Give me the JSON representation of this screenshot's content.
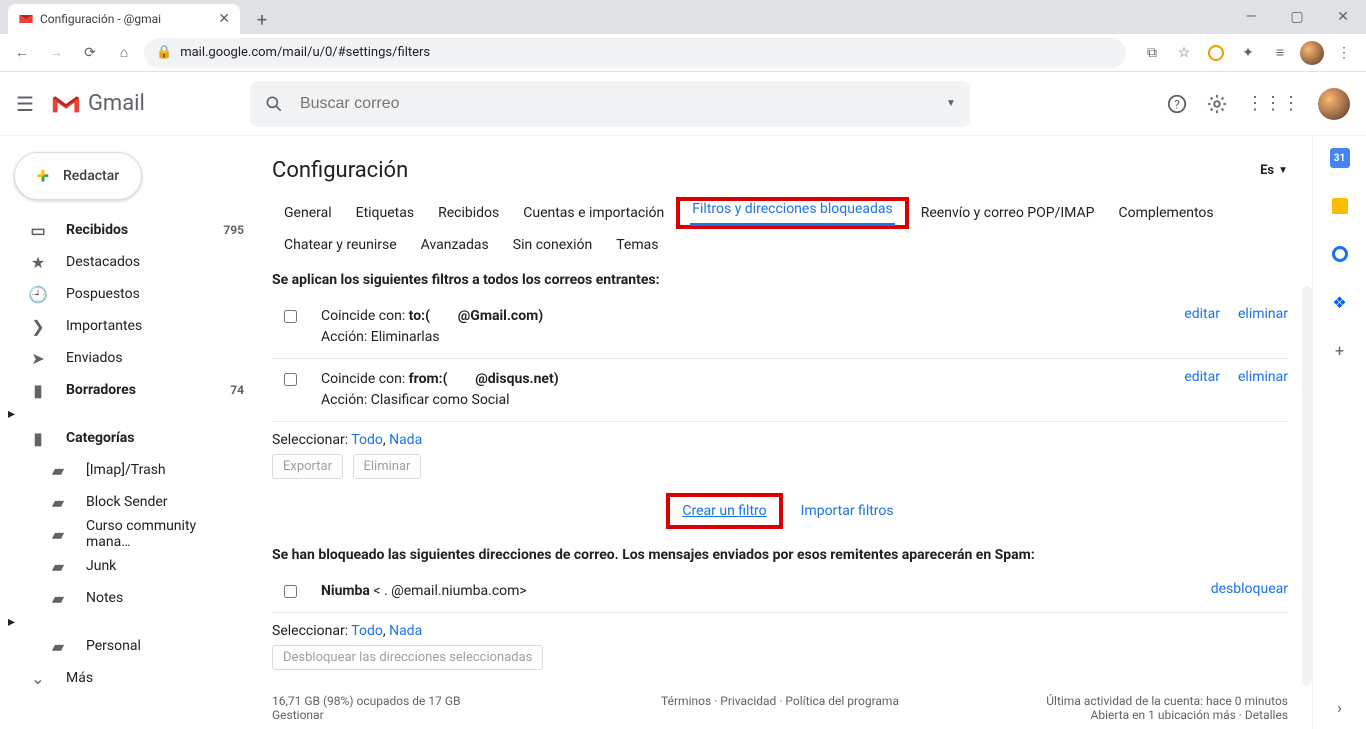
{
  "browser": {
    "tab": {
      "title": "Configuración -         @gmai",
      "favicon": "M"
    },
    "url": "mail.google.com/mail/u/0/#settings/filters"
  },
  "header": {
    "product": "Gmail",
    "search_placeholder": "Buscar correo"
  },
  "sidebar": {
    "compose": "Redactar",
    "items": [
      {
        "icon": "inbox",
        "label": "Recibidos",
        "count": "795",
        "bold": true
      },
      {
        "icon": "star",
        "label": "Destacados"
      },
      {
        "icon": "clock",
        "label": "Pospuestos"
      },
      {
        "icon": "important",
        "label": "Importantes"
      },
      {
        "icon": "sent",
        "label": "Enviados"
      },
      {
        "icon": "file",
        "label": "Borradores",
        "count": "74",
        "bold": true
      },
      {
        "icon": "file",
        "label": "Categorías",
        "bold": true,
        "caret": true
      },
      {
        "icon": "label",
        "label": "[Imap]/Trash",
        "sub": true
      },
      {
        "icon": "label",
        "label": "Block Sender",
        "sub": true
      },
      {
        "icon": "label",
        "label": "Curso community mana…",
        "sub": true
      },
      {
        "icon": "label",
        "label": "Junk",
        "sub": true
      },
      {
        "icon": "label",
        "label": "Notes",
        "sub": true
      },
      {
        "icon": "label",
        "label": "Personal",
        "sub": true,
        "caret": true
      },
      {
        "icon": "chev",
        "label": "Más"
      }
    ]
  },
  "settings": {
    "title": "Configuración",
    "lang": "Es",
    "tabs": [
      "General",
      "Etiquetas",
      "Recibidos",
      "Cuentas e importación",
      "Filtros y direcciones bloqueadas",
      "Reenvío y correo POP/IMAP",
      "Complementos",
      "Chatear y reunirse",
      "Avanzadas",
      "Sin conexión",
      "Temas"
    ],
    "active_tab_index": 4,
    "filters_header": "Se aplican los siguientes filtros a todos los correos entrantes:",
    "filters": [
      {
        "match_prefix": "Coincide con: ",
        "match_bold": "to:(",
        "match_suffix": "@Gmail.com)",
        "action": "Acción: Eliminarlas"
      },
      {
        "match_prefix": "Coincide con: ",
        "match_bold": "from:(",
        "match_suffix": "@disqus.net)",
        "action": "Acción: Clasificar como Social"
      }
    ],
    "edit": "editar",
    "delete": "eliminar",
    "select_label": "Seleccionar: ",
    "select_all": "Todo",
    "select_none": "Nada",
    "export": "Exportar",
    "delete_btn": "Eliminar",
    "create_filter": "Crear un filtro",
    "import_filters": "Importar filtros",
    "blocked_header": "Se han bloqueado las siguientes direcciones de correo. Los mensajes enviados por esos remitentes aparecerán en Spam:",
    "blocked": [
      {
        "name": "Niumba",
        "addr": "<  .    @email.niumba.com>"
      }
    ],
    "unblock": "desbloquear",
    "unblock_selected": "Desbloquear las direcciones seleccionadas"
  },
  "footer": {
    "storage_line": "16,71 GB (98%) ocupados de 17 GB",
    "manage": "Gestionar",
    "terms": "Términos",
    "privacy": "Privacidad",
    "policy": "Política del programa",
    "activity": "Última actividad de la cuenta: hace 0 minutos",
    "open": "Abierta en 1 ubicación más",
    "details": "Detalles"
  },
  "sidepanel": {
    "cal": "31"
  }
}
